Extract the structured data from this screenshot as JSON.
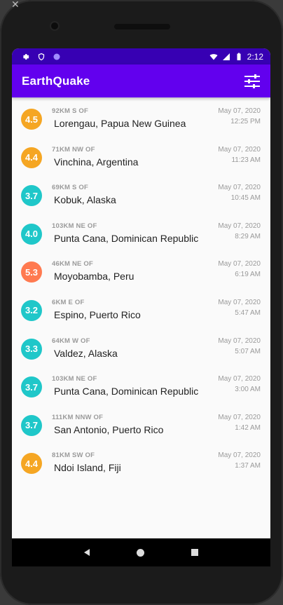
{
  "status_bar": {
    "time": "2:12"
  },
  "app_bar": {
    "title": "EarthQuake"
  },
  "colors": {
    "primary": "#6200ee",
    "primary_dark": "#3700b3",
    "mag_orange": "#f5a623",
    "mag_teal": "#1fc7c9",
    "mag_red": "#ff7a50"
  },
  "earthquakes": [
    {
      "mag": "4.5",
      "offset": "92KM S OF",
      "place": "Lorengau, Papua New Guinea",
      "date": "May 07, 2020",
      "time": "12:25 PM",
      "color": "#f5a623"
    },
    {
      "mag": "4.4",
      "offset": "71KM NW OF",
      "place": "Vinchina, Argentina",
      "date": "May 07, 2020",
      "time": "11:23 AM",
      "color": "#f5a623"
    },
    {
      "mag": "3.7",
      "offset": "69KM S OF",
      "place": "Kobuk, Alaska",
      "date": "May 07, 2020",
      "time": "10:45 AM",
      "color": "#1fc7c9"
    },
    {
      "mag": "4.0",
      "offset": "103KM NE OF",
      "place": "Punta Cana, Dominican Republic",
      "date": "May 07, 2020",
      "time": "8:29 AM",
      "color": "#1fc7c9"
    },
    {
      "mag": "5.3",
      "offset": "46KM NE OF",
      "place": "Moyobamba, Peru",
      "date": "May 07, 2020",
      "time": "6:19 AM",
      "color": "#ff7a50"
    },
    {
      "mag": "3.2",
      "offset": "6KM E OF",
      "place": "Espino, Puerto Rico",
      "date": "May 07, 2020",
      "time": "5:47 AM",
      "color": "#1fc7c9"
    },
    {
      "mag": "3.3",
      "offset": "64KM W OF",
      "place": "Valdez, Alaska",
      "date": "May 07, 2020",
      "time": "5:07 AM",
      "color": "#1fc7c9"
    },
    {
      "mag": "3.7",
      "offset": "103KM NE OF",
      "place": "Punta Cana, Dominican Republic",
      "date": "May 07, 2020",
      "time": "3:00 AM",
      "color": "#1fc7c9"
    },
    {
      "mag": "3.7",
      "offset": "111KM NNW OF",
      "place": "San Antonio, Puerto Rico",
      "date": "May 07, 2020",
      "time": "1:42 AM",
      "color": "#1fc7c9"
    },
    {
      "mag": "4.4",
      "offset": "81KM SW OF",
      "place": "Ndoi Island, Fiji",
      "date": "May 07, 2020",
      "time": "1:37 AM",
      "color": "#f5a623"
    }
  ]
}
